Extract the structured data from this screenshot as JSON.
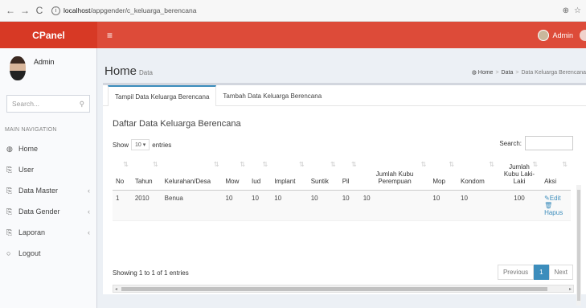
{
  "browser": {
    "url_host": "localhost",
    "url_path": "/appgender/c_keluarga_berencana"
  },
  "header": {
    "logo": "CPanel",
    "user": "Admin"
  },
  "sidebar": {
    "user_name": "Admin",
    "search_placeholder": "Search...",
    "nav_header": "MAIN NAVIGATION",
    "items": [
      {
        "label": "Home",
        "icon": "dashboard-icon"
      },
      {
        "label": "User",
        "icon": "files-icon"
      },
      {
        "label": "Data Master",
        "icon": "files-icon"
      },
      {
        "label": "Data Gender",
        "icon": "files-icon"
      },
      {
        "label": "Laporan",
        "icon": "files-icon"
      },
      {
        "label": "Logout",
        "icon": "circle-icon"
      }
    ]
  },
  "page": {
    "title": "Home",
    "subtitle": "Data",
    "breadcrumb": [
      "Home",
      "Data",
      "Data Keluarga Berencana"
    ]
  },
  "tabs": [
    {
      "label": "Tampil Data Keluarga Berencana",
      "active": true
    },
    {
      "label": "Tambah Data Keluarga Berencana",
      "active": false
    }
  ],
  "box_title": "Daftar Data Keluarga Berencana",
  "datatable": {
    "show_label": "Show",
    "length_value": "10",
    "entries_label": "entries",
    "search_label": "Search:",
    "columns": [
      "No",
      "Tahun",
      "Kelurahan/Desa",
      "Mow",
      "Iud",
      "Implant",
      "Suntik",
      "Pil",
      "Jumlah Kubu Perempuan",
      "Mop",
      "Kondom",
      "Jumlah Kubu Laki-Laki",
      "Aksi"
    ],
    "rows": [
      [
        "1",
        "2010",
        "Benua",
        "10",
        "10",
        "10",
        "10",
        "10",
        "10",
        "10",
        "10",
        "100"
      ]
    ],
    "action_edit": "Edit",
    "action_delete": "Hapus",
    "info": "Showing 1 to 1 of 1 entries",
    "previous": "Previous",
    "current_page": "1",
    "next": "Next"
  }
}
